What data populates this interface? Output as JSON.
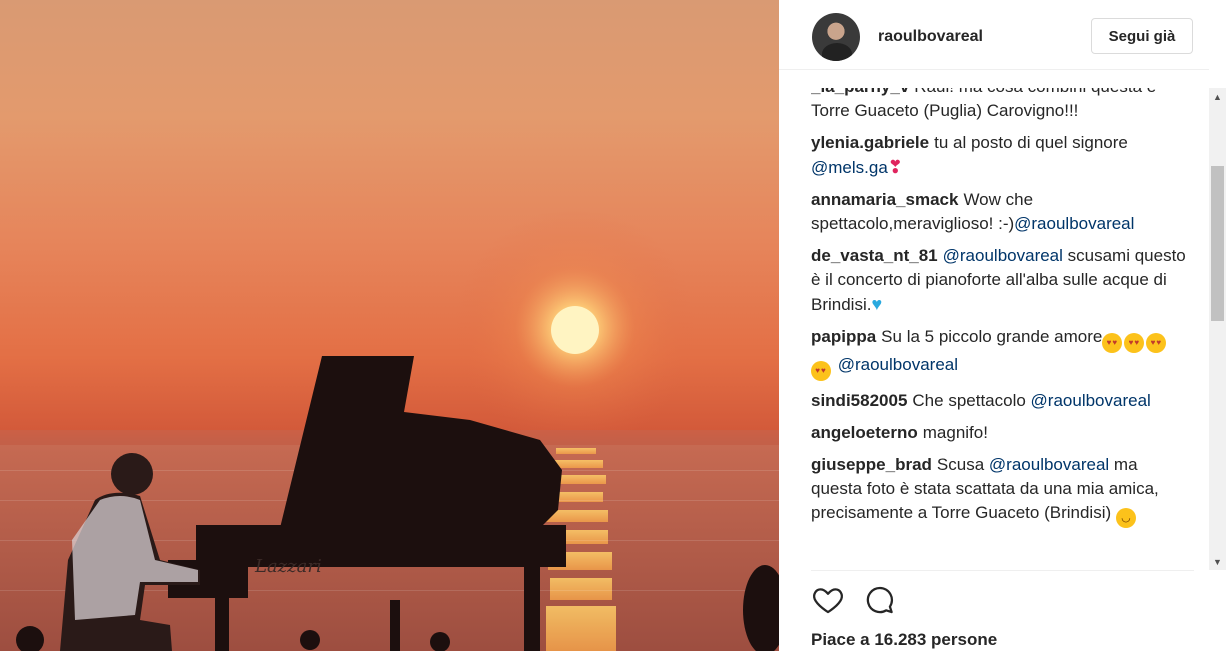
{
  "post": {
    "username": "raoulbovareal",
    "follow_label": "Segui già",
    "likes_text": "Piace a 16.283 persone"
  },
  "photo": {
    "piano_brand": "Lazzari",
    "colors": {
      "sky_top": "#d99a73",
      "sky_mid": "#e6845a",
      "sea": "#b85a45",
      "sun": "#fff3b0",
      "silhouette": "#1a0d0c"
    }
  },
  "comments": [
    {
      "user": "_la_parny_v",
      "parts": [
        {
          "t": "Raul! ma cosa combini questa è Torre Guaceto (Puglia) Carovigno!!!"
        }
      ]
    },
    {
      "user": "ylenia.gabriele",
      "parts": [
        {
          "t": "tu al posto di quel signore "
        },
        {
          "m": "@mels.ga"
        },
        {
          "e": "hearts"
        }
      ]
    },
    {
      "user": "annamaria_smack",
      "parts": [
        {
          "t": "Wow che spettacolo,meraviglioso! :-)"
        },
        {
          "m": "@raoulbovareal"
        }
      ]
    },
    {
      "user": "de_vasta_nt_81",
      "parts": [
        {
          "m": "@raoulbovareal"
        },
        {
          "t": " scusami questo è il concerto di pianoforte all'alba sulle acque di Brindisi."
        },
        {
          "e": "blue-heart"
        }
      ]
    },
    {
      "user": "papippa",
      "parts": [
        {
          "t": "Su la 5 piccolo grande amore"
        },
        {
          "e": "heart-eyes"
        },
        {
          "e": "heart-eyes"
        },
        {
          "e": "heart-eyes"
        },
        {
          "e": "heart-eyes"
        },
        {
          "t": " "
        },
        {
          "m": "@raoulbovareal"
        }
      ]
    },
    {
      "user": "sindi582005",
      "parts": [
        {
          "t": "Che spettacolo "
        },
        {
          "m": "@raoulbovareal"
        }
      ]
    },
    {
      "user": "angeloeterno",
      "parts": [
        {
          "t": "magnifo!"
        }
      ]
    },
    {
      "user": "giuseppe_brad",
      "parts": [
        {
          "t": "Scusa "
        },
        {
          "m": "@raoulbovareal"
        },
        {
          "t": " ma questa foto è stata scattata da una mia amica, precisamente a Torre Guaceto (Brindisi) "
        },
        {
          "e": "sweat-smile"
        }
      ]
    }
  ],
  "icons": {
    "like": "heart-outline-icon",
    "comment": "speech-bubble-icon"
  }
}
